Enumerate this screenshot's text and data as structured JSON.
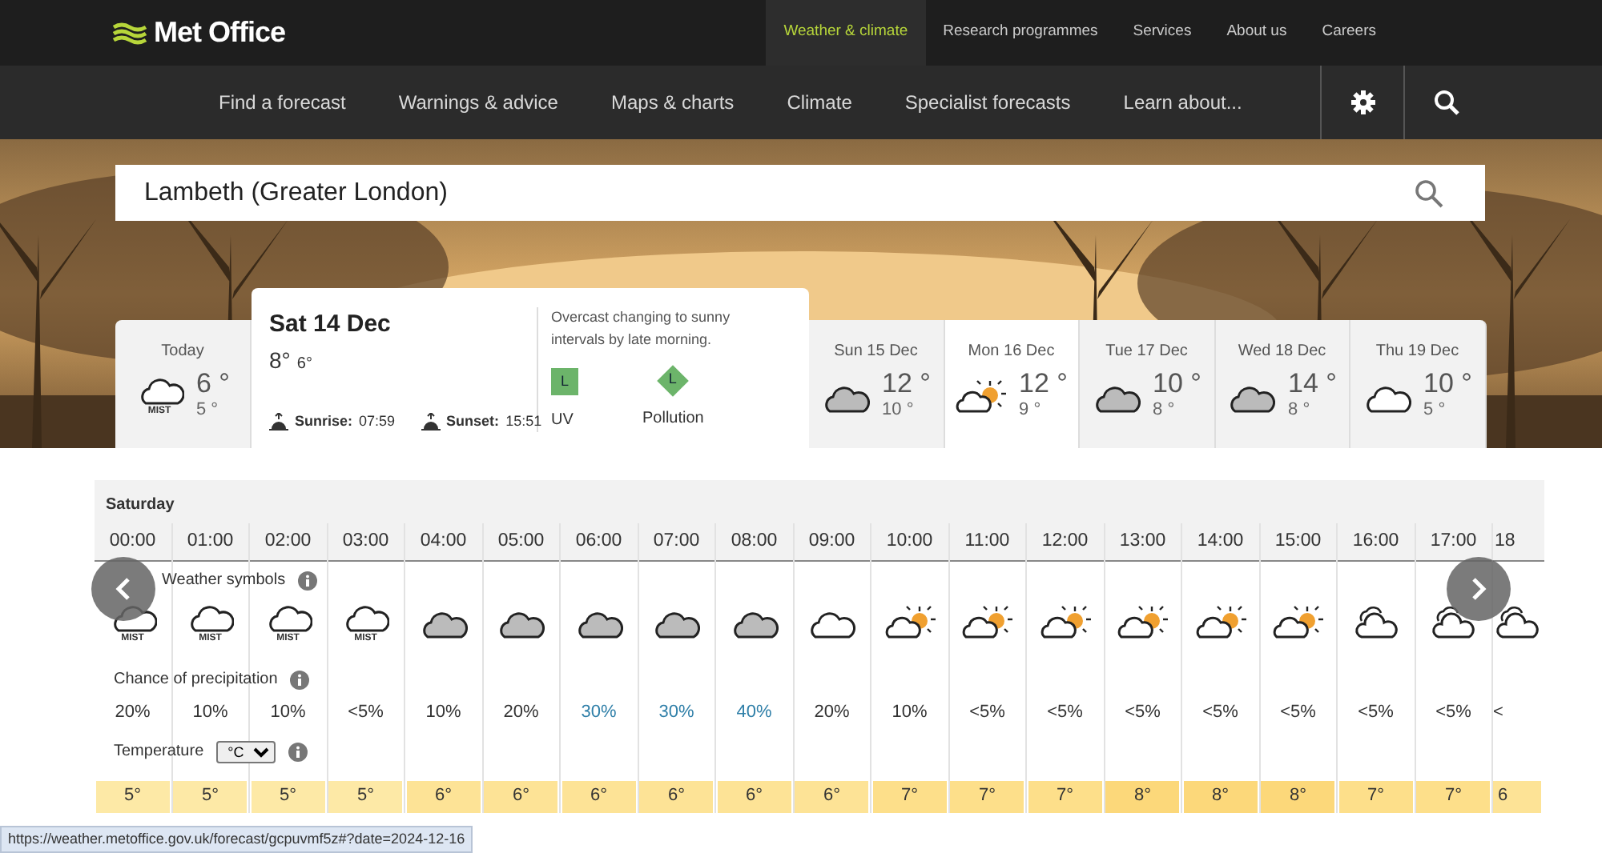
{
  "header": {
    "logo": "Met Office",
    "top_nav": [
      {
        "label": "Weather & climate",
        "selected": true
      },
      {
        "label": "Research programmes",
        "selected": false
      },
      {
        "label": "Services",
        "selected": false
      },
      {
        "label": "About us",
        "selected": false
      },
      {
        "label": "Careers",
        "selected": false
      }
    ],
    "main_nav": [
      "Find a forecast",
      "Warnings & advice",
      "Maps & charts",
      "Climate",
      "Specialist forecasts",
      "Learn about..."
    ]
  },
  "search": {
    "value": "Lambeth (Greater London)"
  },
  "today": {
    "label": "Today",
    "symbol": {
      "kind": "mist",
      "text": "MIST"
    },
    "high": "6 °",
    "low": "5 °"
  },
  "selected_day": {
    "title": "Sat 14 Dec",
    "high": "8°",
    "low": "6°",
    "sunrise_label": "Sunrise:",
    "sunrise": "07:59",
    "sunset_label": "Sunset:",
    "sunset": "15:51",
    "summary": "Overcast changing to sunny intervals by late morning.",
    "uv": {
      "value": "L",
      "label": "UV"
    },
    "pollution": {
      "value": "L",
      "label": "Pollution"
    }
  },
  "days": [
    {
      "label": "Sun 15 Dec",
      "symbol": {
        "kind": "overcast"
      },
      "high": "12 °",
      "low": "10 °",
      "highlighted": false
    },
    {
      "label": "Mon 16 Dec",
      "symbol": {
        "kind": "sunny-intervals"
      },
      "high": "12 °",
      "low": "9 °",
      "highlighted": true
    },
    {
      "label": "Tue 17 Dec",
      "symbol": {
        "kind": "overcast"
      },
      "high": "10 °",
      "low": "8 °",
      "highlighted": false
    },
    {
      "label": "Wed 18 Dec",
      "symbol": {
        "kind": "overcast"
      },
      "high": "14 °",
      "low": "8 °",
      "highlighted": false
    },
    {
      "label": "Thu 19 Dec",
      "symbol": {
        "kind": "cloudy"
      },
      "high": "10 °",
      "low": "5 °",
      "highlighted": false
    }
  ],
  "hourly": {
    "day": "Saturday",
    "symbols_label": "Weather symbols",
    "precip_label": "Chance of precipitation",
    "temp_label": "Temperature",
    "unit": "°C",
    "hours": [
      {
        "time": "00:00",
        "symbol": {
          "kind": "mist",
          "text": "MIST"
        },
        "precip": {
          "value": "20%",
          "color": "#333333"
        },
        "temp": {
          "value": "5°",
          "color": "#fde9a6"
        }
      },
      {
        "time": "01:00",
        "symbol": {
          "kind": "mist",
          "text": "MIST"
        },
        "precip": {
          "value": "10%",
          "color": "#333333"
        },
        "temp": {
          "value": "5°",
          "color": "#fde9a6"
        }
      },
      {
        "time": "02:00",
        "symbol": {
          "kind": "mist",
          "text": "MIST"
        },
        "precip": {
          "value": "10%",
          "color": "#333333"
        },
        "temp": {
          "value": "5°",
          "color": "#fde9a6"
        }
      },
      {
        "time": "03:00",
        "symbol": {
          "kind": "mist",
          "text": "MIST"
        },
        "precip": {
          "value": "<5%",
          "color": "#333333"
        },
        "temp": {
          "value": "5°",
          "color": "#fde9a6"
        }
      },
      {
        "time": "04:00",
        "symbol": {
          "kind": "overcast"
        },
        "precip": {
          "value": "10%",
          "color": "#333333"
        },
        "temp": {
          "value": "6°",
          "color": "#fde396"
        }
      },
      {
        "time": "05:00",
        "symbol": {
          "kind": "overcast"
        },
        "precip": {
          "value": "20%",
          "color": "#333333"
        },
        "temp": {
          "value": "6°",
          "color": "#fde396"
        }
      },
      {
        "time": "06:00",
        "symbol": {
          "kind": "overcast"
        },
        "precip": {
          "value": "30%",
          "color": "#2f7fa8"
        },
        "temp": {
          "value": "6°",
          "color": "#fde396"
        }
      },
      {
        "time": "07:00",
        "symbol": {
          "kind": "overcast"
        },
        "precip": {
          "value": "30%",
          "color": "#2f7fa8"
        },
        "temp": {
          "value": "6°",
          "color": "#fde396"
        }
      },
      {
        "time": "08:00",
        "symbol": {
          "kind": "overcast"
        },
        "precip": {
          "value": "40%",
          "color": "#2f7fa8"
        },
        "temp": {
          "value": "6°",
          "color": "#fde396"
        }
      },
      {
        "time": "09:00",
        "symbol": {
          "kind": "cloudy"
        },
        "precip": {
          "value": "20%",
          "color": "#333333"
        },
        "temp": {
          "value": "6°",
          "color": "#fde396"
        }
      },
      {
        "time": "10:00",
        "symbol": {
          "kind": "sunny-intervals"
        },
        "precip": {
          "value": "10%",
          "color": "#333333"
        },
        "temp": {
          "value": "7°",
          "color": "#fddf8a"
        }
      },
      {
        "time": "11:00",
        "symbol": {
          "kind": "sunny-intervals"
        },
        "precip": {
          "value": "<5%",
          "color": "#333333"
        },
        "temp": {
          "value": "7°",
          "color": "#fddf8a"
        }
      },
      {
        "time": "12:00",
        "symbol": {
          "kind": "sunny-intervals"
        },
        "precip": {
          "value": "<5%",
          "color": "#333333"
        },
        "temp": {
          "value": "7°",
          "color": "#fddf8a"
        }
      },
      {
        "time": "13:00",
        "symbol": {
          "kind": "sunny-intervals"
        },
        "precip": {
          "value": "<5%",
          "color": "#333333"
        },
        "temp": {
          "value": "8°",
          "color": "#fcd87a"
        }
      },
      {
        "time": "14:00",
        "symbol": {
          "kind": "sunny-intervals"
        },
        "precip": {
          "value": "<5%",
          "color": "#333333"
        },
        "temp": {
          "value": "8°",
          "color": "#fcd87a"
        }
      },
      {
        "time": "15:00",
        "symbol": {
          "kind": "sunny-intervals"
        },
        "precip": {
          "value": "<5%",
          "color": "#333333"
        },
        "temp": {
          "value": "8°",
          "color": "#fcd87a"
        }
      },
      {
        "time": "16:00",
        "symbol": {
          "kind": "two-clouds"
        },
        "precip": {
          "value": "<5%",
          "color": "#333333"
        },
        "temp": {
          "value": "7°",
          "color": "#fddf8a"
        }
      },
      {
        "time": "17:00",
        "symbol": {
          "kind": "two-clouds"
        },
        "precip": {
          "value": "<5%",
          "color": "#333333"
        },
        "temp": {
          "value": "7°",
          "color": "#fddf8a"
        }
      },
      {
        "time": "18",
        "symbol": {
          "kind": "two-clouds"
        },
        "precip": {
          "value": "<",
          "color": "#333333"
        },
        "temp": {
          "value": "6",
          "color": "#fde396"
        }
      }
    ]
  },
  "status_url": "https://weather.metoffice.gov.uk/forecast/gcpuvmf5z#?date=2024-12-16"
}
